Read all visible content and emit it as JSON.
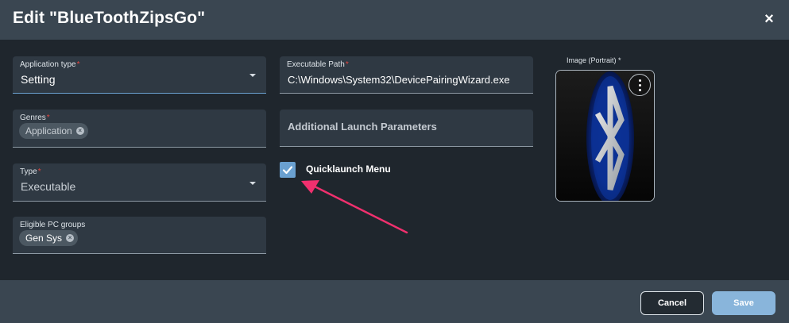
{
  "dialog": {
    "title": "Edit \"BlueToothZipsGo\"",
    "close_icon": "×"
  },
  "left": {
    "application_type": {
      "label": "Application type",
      "required_mark": "*",
      "value": "Setting"
    },
    "genres": {
      "label": "Genres",
      "required_mark": "*",
      "chip": "Application"
    },
    "type": {
      "label": "Type",
      "required_mark": "*",
      "value": "Executable"
    },
    "eligible_pc_groups": {
      "label": "Eligible PC groups",
      "chip": "Gen Sys"
    }
  },
  "middle": {
    "executable_path": {
      "label": "Executable Path",
      "required_mark": "*",
      "value": "C:\\Windows\\System32\\DevicePairingWizard.exe"
    },
    "launch_params": {
      "placeholder": "Additional Launch Parameters"
    },
    "quicklaunch": {
      "label": "Quicklaunch Menu",
      "checked": true
    }
  },
  "image": {
    "label": "Image (Portrait) *",
    "icon": "bluetooth-icon",
    "menu_icon": "kebab-menu-icon"
  },
  "footer": {
    "cancel_label": "Cancel",
    "save_label": "Save"
  },
  "colors": {
    "accent": "#6aa0d0",
    "header": "#3a4651",
    "body": "#1f262d",
    "field": "#2f3943",
    "required": "#e0453f",
    "annotation_arrow": "#f0306e"
  }
}
